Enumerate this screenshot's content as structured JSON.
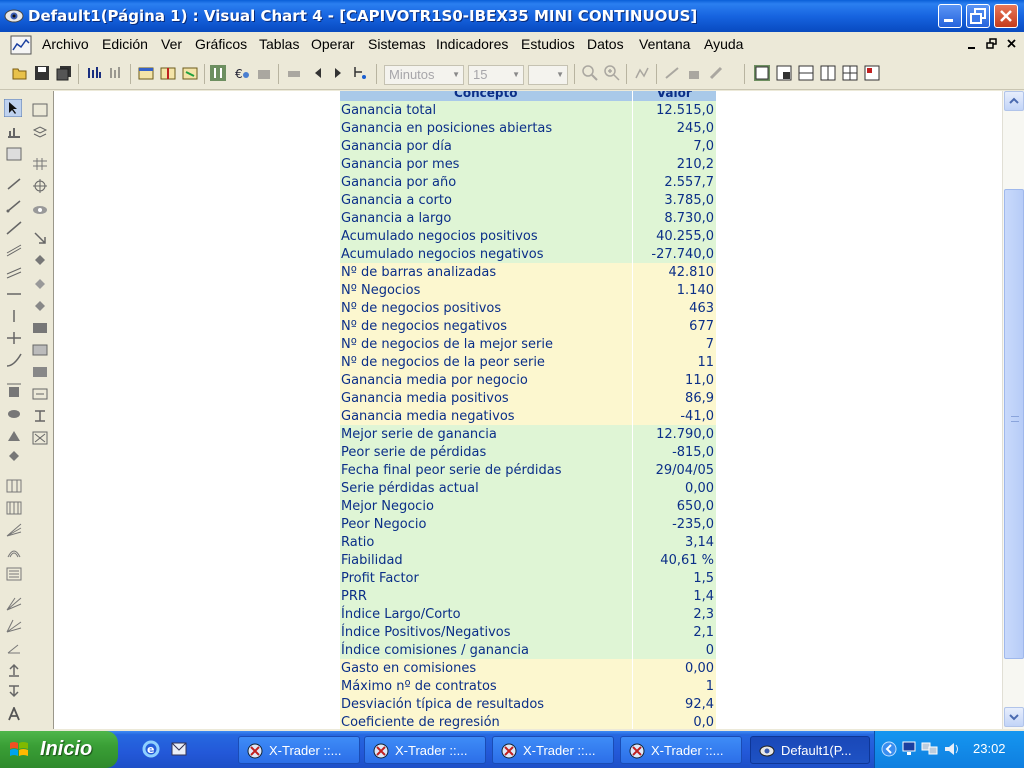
{
  "window": {
    "title": "Default1(Página 1) : Visual Chart 4 - [CAPIVOTR1S0-IBEX35 MINI CONTINUOUS]"
  },
  "menu": {
    "items": [
      "Archivo",
      "Edición",
      "Ver",
      "Gráficos",
      "Tablas",
      "Operar",
      "Sistemas",
      "Indicadores",
      "Estudios",
      "Datos",
      "Ventana",
      "Ayuda"
    ]
  },
  "toolbar": {
    "period_combo": "Minutos",
    "interval_combo": "15",
    "blank_combo": ""
  },
  "table": {
    "headers": {
      "concept": "Concepto",
      "value": "Valor"
    },
    "rows": [
      {
        "c": "Ganancia total",
        "v": "12.515,0",
        "tone": "g"
      },
      {
        "c": "Ganancia en posiciones abiertas",
        "v": "245,0",
        "tone": "g"
      },
      {
        "c": "Ganancia por día",
        "v": "7,0",
        "tone": "g"
      },
      {
        "c": "Ganancia por mes",
        "v": "210,2",
        "tone": "g"
      },
      {
        "c": "Ganancia por año",
        "v": "2.557,7",
        "tone": "g"
      },
      {
        "c": "Ganancia a corto",
        "v": "3.785,0",
        "tone": "g"
      },
      {
        "c": "Ganancia a largo",
        "v": "8.730,0",
        "tone": "g"
      },
      {
        "c": "Acumulado negocios positivos",
        "v": "40.255,0",
        "tone": "g"
      },
      {
        "c": "Acumulado negocios negativos",
        "v": "-27.740,0",
        "tone": "g"
      },
      {
        "c": "Nº de barras analizadas",
        "v": "42.810",
        "tone": "y"
      },
      {
        "c": "Nº Negocios",
        "v": "1.140",
        "tone": "y"
      },
      {
        "c": "Nº de negocios positivos",
        "v": "463",
        "tone": "y"
      },
      {
        "c": "Nº de negocios negativos",
        "v": "677",
        "tone": "y"
      },
      {
        "c": "Nº de negocios de la mejor serie",
        "v": "7",
        "tone": "y"
      },
      {
        "c": "Nº de negocios de la peor serie",
        "v": "11",
        "tone": "y"
      },
      {
        "c": "Ganancia media por negocio",
        "v": "11,0",
        "tone": "y"
      },
      {
        "c": "Ganancia media positivos",
        "v": "86,9",
        "tone": "y"
      },
      {
        "c": "Ganancia media negativos",
        "v": "-41,0",
        "tone": "y"
      },
      {
        "c": "Mejor serie de ganancia",
        "v": "12.790,0",
        "tone": "g"
      },
      {
        "c": "Peor serie de pérdidas",
        "v": "-815,0",
        "tone": "g"
      },
      {
        "c": "Fecha final peor serie de pérdidas",
        "v": "29/04/05",
        "tone": "g"
      },
      {
        "c": "Serie pérdidas actual",
        "v": "0,00",
        "tone": "g"
      },
      {
        "c": "Mejor Negocio",
        "v": "650,0",
        "tone": "g"
      },
      {
        "c": "Peor Negocio",
        "v": "-235,0",
        "tone": "g"
      },
      {
        "c": "Ratio",
        "v": "3,14",
        "tone": "g"
      },
      {
        "c": "Fiabilidad",
        "v": "40,61 %",
        "tone": "g"
      },
      {
        "c": "Profit Factor",
        "v": "1,5",
        "tone": "g"
      },
      {
        "c": "PRR",
        "v": "1,4",
        "tone": "g"
      },
      {
        "c": "Índice Largo/Corto",
        "v": "2,3",
        "tone": "g"
      },
      {
        "c": "Índice Positivos/Negativos",
        "v": "2,1",
        "tone": "g"
      },
      {
        "c": "Índice comisiones / ganancia",
        "v": "0",
        "tone": "g"
      },
      {
        "c": "Gasto en comisiones",
        "v": "0,00",
        "tone": "y"
      },
      {
        "c": "Máximo nº de contratos",
        "v": "1",
        "tone": "y"
      },
      {
        "c": "Desviación típica de resultados",
        "v": "92,4",
        "tone": "y"
      },
      {
        "c": "Coeficiente de regresión",
        "v": "0,0",
        "tone": "y"
      }
    ]
  },
  "taskbar": {
    "start_label": "Inicio",
    "tasks": [
      {
        "label": "X-Trader ::...",
        "active": false
      },
      {
        "label": "X-Trader ::...",
        "active": false
      },
      {
        "label": "X-Trader ::...",
        "active": false
      },
      {
        "label": "X-Trader ::...",
        "active": false
      },
      {
        "label": "Default1(P...",
        "active": true
      }
    ],
    "clock": "23:02"
  },
  "colors": {
    "title_blue": "#0b50c8",
    "row_green": "#dff5d5",
    "row_yellow": "#fcf7cf",
    "header_blue": "#a9c9e9",
    "text_navy": "#0b2f88",
    "start_green": "#3a9f36"
  }
}
